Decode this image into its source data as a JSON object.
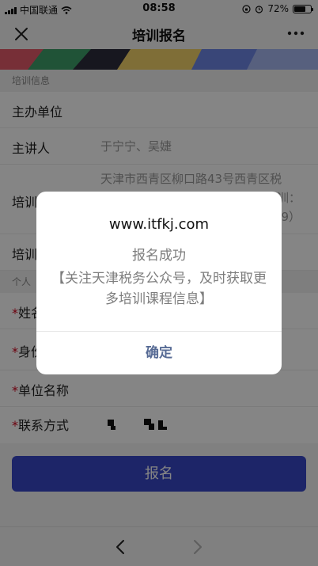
{
  "status_bar": {
    "carrier": "中国联通",
    "time": "08:58",
    "battery": "72%"
  },
  "nav": {
    "title": "培训报名",
    "close_icon": "close-icon",
    "more_icon": "more-icon"
  },
  "form": {
    "section_training": "培训信息",
    "organizer_label": "主办单位",
    "lecturer_label": "主讲人",
    "lecturer_value": "于宁宁、吴婕",
    "address_label": "培训",
    "address_value_line1": "天津市西青区柳口路43号西青区税",
    "address_value_line2": "训：",
    "address_value_line3": "59）",
    "time_label": "培训",
    "section_personal": "个人",
    "name_label": "姓名",
    "id_label": "身份",
    "company_label": "单位名称",
    "contact_label": "联系方式",
    "required_mark": "*",
    "submit_label": "报名"
  },
  "dialog": {
    "title": "www.itfkj.com",
    "message_line1": "报名成功",
    "message_line2": "【关注天津税务公众号，及时获取更多培训课程信息】",
    "confirm_label": "确定"
  },
  "colors": {
    "primary": "#3848c7",
    "dialog_button": "#576b95",
    "required": "#d0021b"
  }
}
